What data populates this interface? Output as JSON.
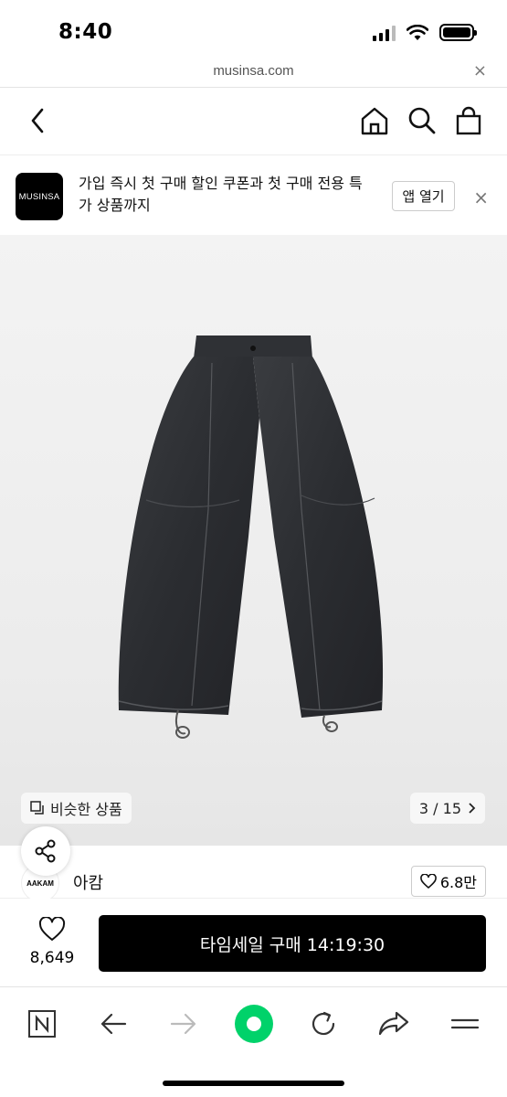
{
  "status_bar": {
    "time": "8:40"
  },
  "browser": {
    "url": "musinsa.com",
    "close": "×"
  },
  "banner": {
    "logo": "MUSINSA",
    "text": "가입 즉시 첫 구매 할인 쿠폰과 첫 구매 전용 특가 상품까지",
    "open_app": "앱 열기",
    "close": "×"
  },
  "product": {
    "similar_label": "비슷한 상품",
    "counter": "3 / 15"
  },
  "brand": {
    "logo": "AAKAM",
    "name": "아캄",
    "likes": "6.8만"
  },
  "purchase": {
    "wish_count": "8,649",
    "buy_label": "타임세일 구매 14:19:30"
  },
  "colors": {
    "accent_green": "#00d26a",
    "button_black": "#000000"
  }
}
